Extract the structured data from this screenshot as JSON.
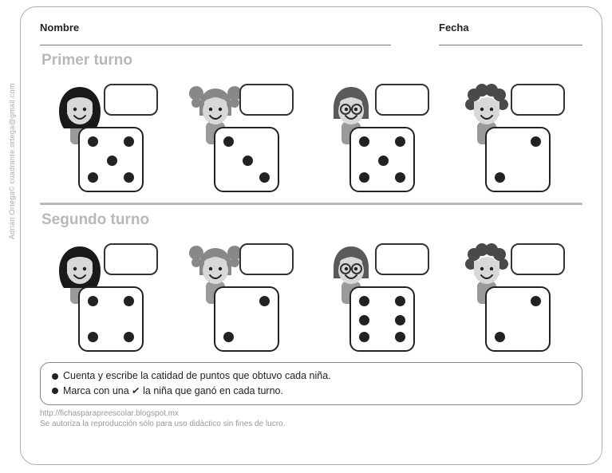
{
  "header": {
    "name_label": "Nombre",
    "date_label": "Fecha"
  },
  "turns": [
    {
      "title": "Primer turno",
      "items": [
        {
          "kid": "girl-black-hair",
          "hair_color": "#1a1a1a",
          "die_value": 5,
          "pips": [
            "tl",
            "tr",
            "c",
            "bl",
            "br"
          ]
        },
        {
          "kid": "girl-pigtails",
          "hair_color": "#888888",
          "die_value": 3,
          "pips": [
            "tl",
            "c",
            "br"
          ]
        },
        {
          "kid": "girl-glasses",
          "hair_color": "#5a5a5a",
          "die_value": 5,
          "pips": [
            "tl",
            "tr",
            "c",
            "bl",
            "br"
          ]
        },
        {
          "kid": "girl-curly",
          "hair_color": "#4a4a4a",
          "die_value": 2,
          "pips": [
            "tr",
            "bl"
          ]
        }
      ]
    },
    {
      "title": "Segundo turno",
      "items": [
        {
          "kid": "girl-black-hair",
          "hair_color": "#1a1a1a",
          "die_value": 4,
          "pips": [
            "tl",
            "tr",
            "bl",
            "br"
          ]
        },
        {
          "kid": "girl-pigtails",
          "hair_color": "#888888",
          "die_value": 2,
          "pips": [
            "tr",
            "bl"
          ]
        },
        {
          "kid": "girl-glasses",
          "hair_color": "#5a5a5a",
          "die_value": 6,
          "pips": [
            "tl",
            "tr",
            "ml",
            "mr",
            "bl",
            "br"
          ]
        },
        {
          "kid": "girl-curly",
          "hair_color": "#4a4a4a",
          "die_value": 2,
          "pips": [
            "tr",
            "bl"
          ]
        }
      ]
    }
  ],
  "instructions": {
    "line1": "Cuenta y escribe la catidad de puntos que obtuvo cada niña.",
    "line2_prefix": "Marca con una ",
    "line2_check": "✓",
    "line2_suffix": " la niña que ganó en cada turno."
  },
  "footer": {
    "url": "http://fichasparapreescolar.blogspot.mx",
    "license": "Se autoriza la reproducción sólo para uso didáctico sin fines de lucro."
  },
  "credit": "Adrián Ortega© cuadrante.ortega@gmail.com"
}
